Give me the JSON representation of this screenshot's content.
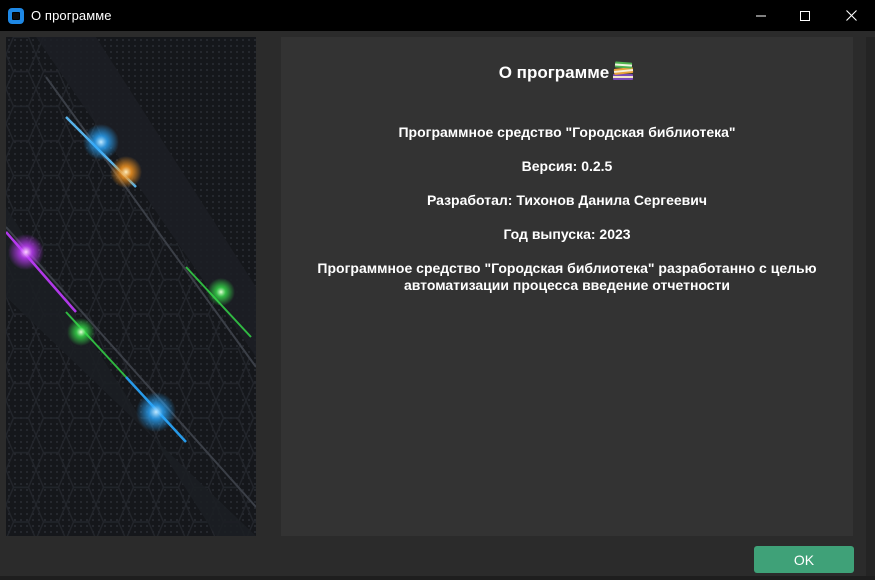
{
  "window": {
    "title": "О программе"
  },
  "titlebar_controls": {
    "minimize_icon": "minimize-icon",
    "maximize_icon": "maximize-icon",
    "close_icon": "close-icon"
  },
  "about": {
    "heading": "О программе",
    "heading_icon": "books-icon",
    "product_line": "Программное средство \"Городская библиотека\"",
    "version_line": "Версия: 0.2.5",
    "developer_line": "Разработал: Тихонов Данила Сергеевич",
    "year_line": "Год выпуска: 2023",
    "description_line1": "Программное средство \"Городская библиотека\" разработанно с целью",
    "description_line2": "автоматизации процесса введение отчетности"
  },
  "buttons": {
    "ok_label": "OK",
    "ok_color": "#3fa178"
  },
  "colors": {
    "titlebar": "#000000",
    "window_bg": "#2b2b2b",
    "content_bg": "#333333",
    "app_icon": "#1e88e5"
  }
}
